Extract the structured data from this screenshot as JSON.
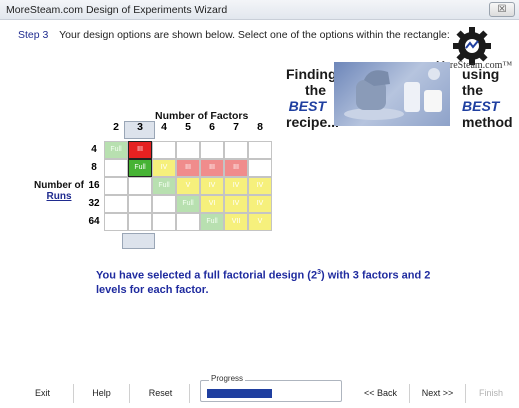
{
  "window": {
    "title": "MoreSteam.com Design of Experiments Wizard",
    "close_glyph": "☒"
  },
  "step": {
    "number": "Step 3",
    "description": "Your design options are shown below.  Select one of the options within the rectangle:"
  },
  "logo": {
    "brand": "MoreSteam.com™",
    "icon": "gear-cog-logo-icon"
  },
  "banner": {
    "left_lines": [
      "Finding",
      "the",
      "BEST",
      "recipe..."
    ],
    "right_lines": [
      "using",
      "the",
      "BEST",
      "method"
    ]
  },
  "grid": {
    "factors_label": "Number of Factors",
    "runs_label_1": "Number of",
    "runs_label_2": "Runs",
    "factors": [
      "2",
      "3",
      "4",
      "5",
      "6",
      "7",
      "8"
    ],
    "runs": [
      "4",
      "8",
      "16",
      "32",
      "64"
    ],
    "selected_factors": "3",
    "selected_runs": "8",
    "cells": [
      [
        "Full",
        "III",
        "",
        "",
        "",
        "",
        ""
      ],
      [
        "",
        "Full",
        "IV",
        "III",
        "III",
        "III",
        ""
      ],
      [
        "",
        "",
        "Full",
        "V",
        "IV",
        "IV",
        "IV"
      ],
      [
        "",
        "",
        "",
        "Full",
        "VI",
        "IV",
        "IV"
      ],
      [
        "",
        "",
        "",
        "",
        "Full",
        "VII",
        "V"
      ]
    ],
    "cell_colors": {
      "full_available": "#b8e0b0",
      "full_selected": "#46b334",
      "res_iv_v": "#f6f07c",
      "res_iii": "#f08c8c",
      "res_iii_selected": "#e52121"
    }
  },
  "message": {
    "text_1": "You have selected a full factorial design (2",
    "superscript": "3",
    "text_2": ") with 3 factors and 2 levels for each factor."
  },
  "footer": {
    "exit": "Exit",
    "help": "Help",
    "reset": "Reset",
    "progress_label": "Progress",
    "progress_fraction": 0.5,
    "back": "<< Back",
    "next": "Next >>",
    "finish": "Finish"
  }
}
